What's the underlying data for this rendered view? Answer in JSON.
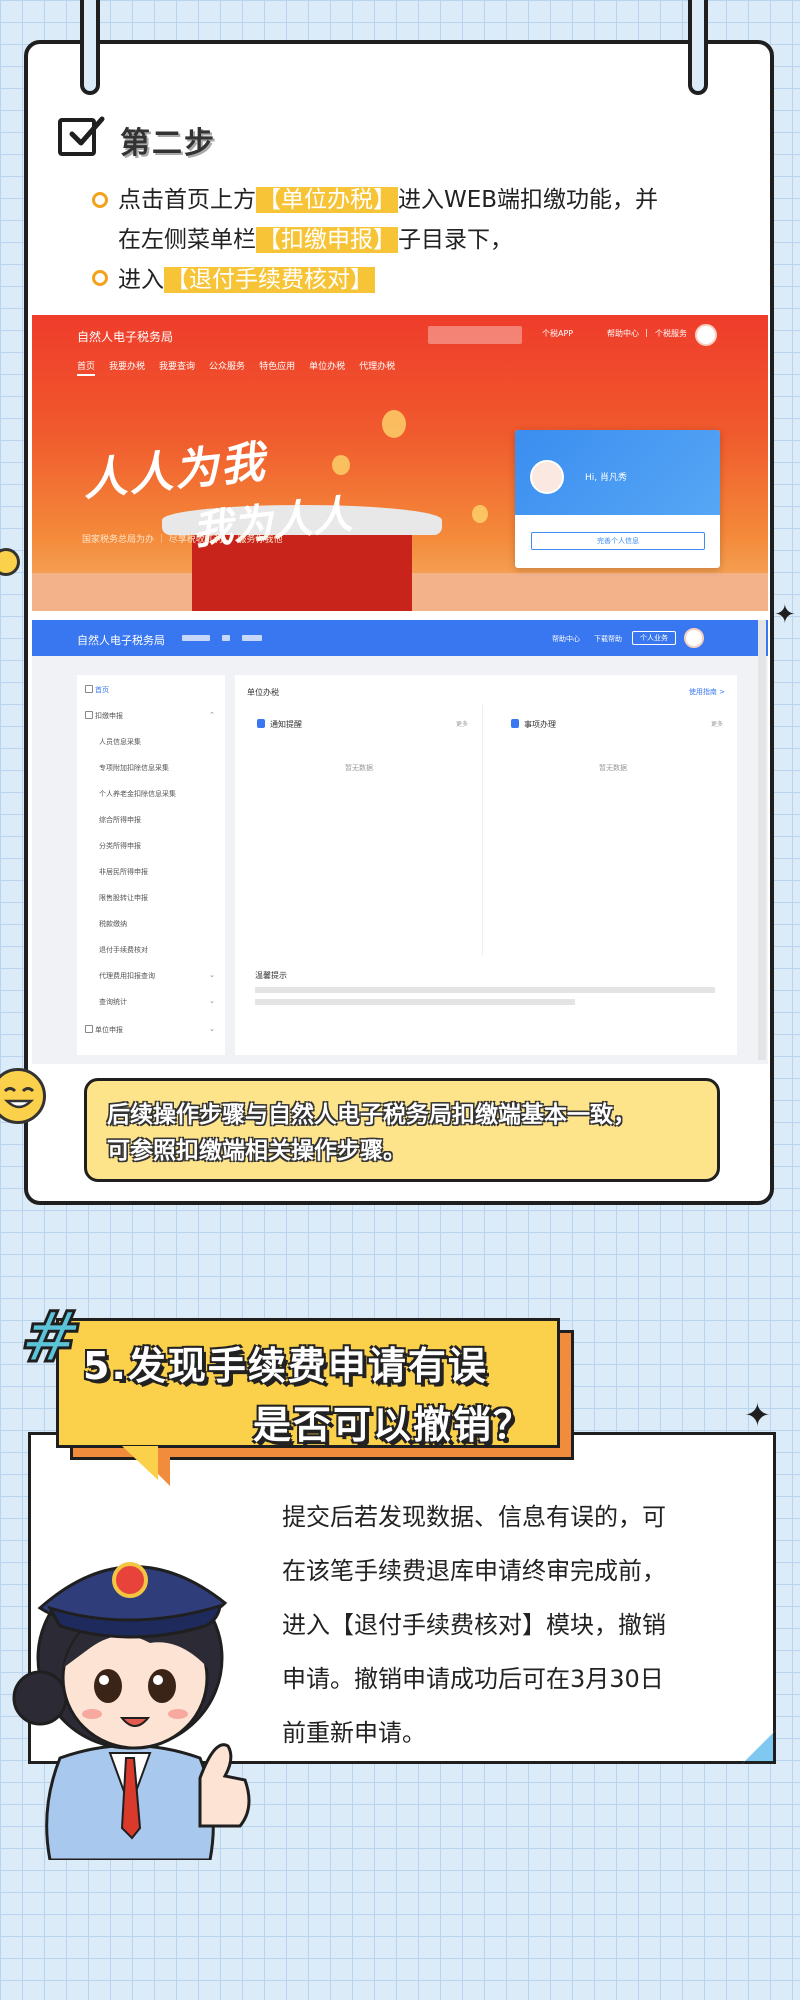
{
  "step": {
    "title": "第二步",
    "line1_pre": "点击首页上方",
    "line1_hl1": "【单位办税】",
    "line1_post": "进入WEB端扣缴功能，并",
    "line2_pre": "在左侧菜单栏",
    "line2_hl": "【扣缴申报】",
    "line2_post": "子目录下，",
    "line3_pre": "进入",
    "line3_hl": "【退付手续费核对】"
  },
  "portal": {
    "brand": "自然人电子税务局",
    "top_links": [
      "个税APP",
      "帮助中心",
      "|",
      "个税服务"
    ],
    "nav": [
      "首页",
      "我要办税",
      "我要查询",
      "公众服务",
      "特色应用",
      "单位办税",
      "代理办税"
    ],
    "slogan1": "人人为我",
    "slogan2": "我为人人",
    "motto": "国家税务总局为办 ｜ 尽享税收红利 ｜ 服务你我他",
    "greeting": "Hi, 肖凡秀",
    "login_btn": "完善个人信息"
  },
  "admin": {
    "brand": "自然人电子税务局",
    "top_links": [
      "帮助中心",
      "下载帮助"
    ],
    "top_btn": "个人业务",
    "sidebar": [
      {
        "label": "首页",
        "level": 0
      },
      {
        "label": "扣缴申报",
        "level": 0
      },
      {
        "label": "人员信息采集",
        "level": 1
      },
      {
        "label": "专项附加扣除信息采集",
        "level": 1
      },
      {
        "label": "个人养老金扣除信息采集",
        "level": 1
      },
      {
        "label": "综合所得申报",
        "level": 1
      },
      {
        "label": "分类所得申报",
        "level": 1
      },
      {
        "label": "非居民所得申报",
        "level": 1
      },
      {
        "label": "限售股转让申报",
        "level": 1
      },
      {
        "label": "税款缴纳",
        "level": 1
      },
      {
        "label": "退付手续费核对",
        "level": 1
      },
      {
        "label": "代理费用扣报查询",
        "level": 1
      },
      {
        "label": "查询统计",
        "level": 1
      },
      {
        "label": "单位申报",
        "level": 0
      }
    ],
    "main_title": "单位办税",
    "main_link": "使用指南 >",
    "panel_left": "通知提醒",
    "panel_right": "事项办理",
    "more": "更多",
    "empty": "暂无数据",
    "tips": "温馨提示"
  },
  "notice": {
    "line1": "后续操作步骤与自然人电子税务局扣缴端基本一致，",
    "line2": "可参照扣缴端相关操作步骤。"
  },
  "section5": {
    "hash": "#",
    "title1": "5.发现手续费申请有误",
    "title2": "是否可以撤销？",
    "para": [
      "提交后若发现数据、信息有误的，可",
      "在该笔手续费退库申请终审完成前，",
      "进入【退付手续费核对】模块，撤销",
      "申请。撤销申请成功后可在3月30日",
      "前重新申请。"
    ]
  },
  "colors": {
    "bg": "#dcebf8",
    "accent_yellow": "#fbd04a",
    "accent_orange": "#f08c3b",
    "highlight": "#f8c437",
    "portal_red": "#ef3c2b",
    "admin_blue": "#3977f0"
  }
}
